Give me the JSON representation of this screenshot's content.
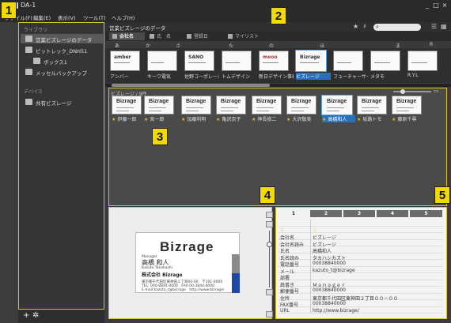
{
  "window": {
    "title": "DA-1",
    "controls": [
      "_",
      "□",
      "×"
    ]
  },
  "menu": [
    "ファイル(F)",
    "編集(E)",
    "表示(V)",
    "ツール(T)",
    "ヘルプ(H)"
  ],
  "badges": [
    "1",
    "2",
    "3",
    "4",
    "5"
  ],
  "sidebar": {
    "library_header": "ライブラリ",
    "items": [
      {
        "label": "営業ビズレージのデータ",
        "selected": true
      },
      {
        "label": "ピットレック_DNH51"
      },
      {
        "label": "ボックス1"
      },
      {
        "label": "メッセルバックアップ"
      }
    ],
    "devices_header": "デバイス",
    "devices": [
      {
        "label": "共有ビズレージ"
      }
    ],
    "add_label": "+",
    "settings_label": "✲"
  },
  "toolbar": {
    "db_title": "営業ビズレージのデータ",
    "search_placeholder": ""
  },
  "tabs": [
    {
      "label": "会社名",
      "active": true
    },
    {
      "label": "氏　名"
    },
    {
      "label": "登録日"
    },
    {
      "label": "マイリスト"
    }
  ],
  "kana_index": [
    "あ",
    "か",
    "さ",
    "た",
    "の",
    "ほ",
    "ま",
    "R"
  ],
  "strip_cards": [
    {
      "label": "アンバー",
      "mark": "amber"
    },
    {
      "label": "キーワ電気",
      "mark": ""
    },
    {
      "label": "佐野コーポレーション",
      "mark": "SANO"
    },
    {
      "label": "トムデザイン",
      "mark": ""
    },
    {
      "label": "新日デザイン事務所",
      "mark": "meoo"
    },
    {
      "label": "ビズレージ",
      "mark": "Bizrage",
      "selected": true
    },
    {
      "label": "フューチャーサイト",
      "mark": ""
    },
    {
      "label": "メタモ",
      "mark": ""
    },
    {
      "label": "R.Y.L",
      "mark": ""
    }
  ],
  "list_panel": {
    "header": "ビズレージ / 9件",
    "cards": [
      {
        "label": "伊藤一郎",
        "logo": "Bizrage"
      },
      {
        "label": "宮一郎",
        "logo": "Bizrage"
      },
      {
        "label": "加藤利明",
        "logo": "Bizrage"
      },
      {
        "label": "亀沢京子",
        "logo": "Bizrage"
      },
      {
        "label": "神長修二",
        "logo": "Bizrage"
      },
      {
        "label": "大沢敬美",
        "logo": "Bizrage"
      },
      {
        "label": "高橋和人",
        "logo": "Bizrage",
        "selected": true
      },
      {
        "label": "坂路トモ",
        "logo": "Bizrage"
      },
      {
        "label": "藤原千尋",
        "logo": "Bizrage"
      }
    ]
  },
  "preview_card": {
    "logo": "Bizrage",
    "title_en": "Manager",
    "name": "高橋 和人",
    "name_romaji": "Kazuto Takahashi",
    "company": "株式会社 Bizrage",
    "address": "東京都千代田区東神田２丁目00-00　〒101-0000",
    "tel": "TEL: 000-8844-0000　FAX:00-3844-0000",
    "email": "E-mail:kazuto_t@bizrage　http://www.bizrage/"
  },
  "detail": {
    "tabs": [
      "1",
      "2",
      "3",
      "4",
      "5"
    ],
    "rows": [
      {
        "key": "",
        "value": ""
      },
      {
        "key": "☆",
        "value": "☆"
      },
      {
        "key": "会社名",
        "value": "ビズレージ"
      },
      {
        "key": "会社名読み",
        "value": "ビズレージ"
      },
      {
        "key": "氏名",
        "value": "高橋和人"
      },
      {
        "key": "氏名読み",
        "value": "タカハシカズト"
      },
      {
        "key": "電話番号",
        "value": "00038840000"
      },
      {
        "key": "メール",
        "value": "kazuto_t@bizrage"
      },
      {
        "key": "部署",
        "value": ""
      },
      {
        "key": "肩書き",
        "value": "Ｍａｎａｇｅｒ"
      },
      {
        "key": "郵便番号",
        "value": "00038840000"
      },
      {
        "key": "住所",
        "value": "東京都千代田区東神田２丁目００－００"
      },
      {
        "key": "FAX番号",
        "value": "00038840000"
      },
      {
        "key": "URL",
        "value": "http://www.bizrage/"
      }
    ]
  },
  "colors": {
    "badge": "#f2d900",
    "accent": "#2a6fb8",
    "border": "#d8c020",
    "card_blue": "#1f48a8"
  }
}
